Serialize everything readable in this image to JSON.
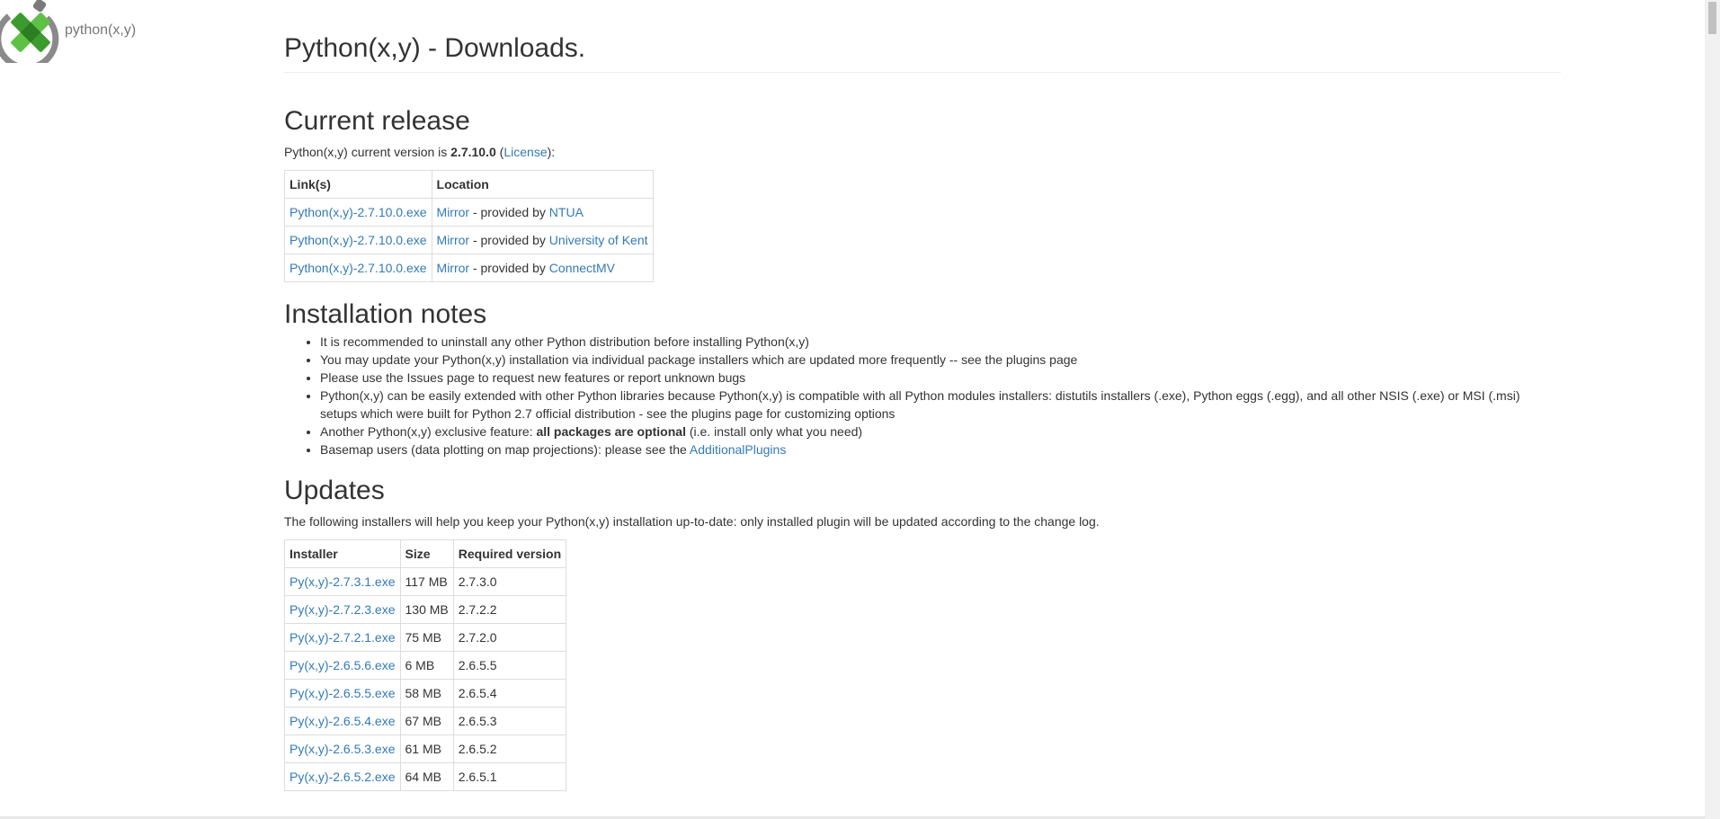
{
  "logo": {
    "icon": "python-xy-logo",
    "text": "python(x,y)"
  },
  "page_title": "Python(x,y) - Downloads.",
  "current_release": {
    "heading": "Current release",
    "intro_prefix": "Python(x,y) current version is ",
    "version": "2.7.10.0",
    "intro_mid": " (",
    "license_link": "License",
    "intro_suffix": "):",
    "table": {
      "headers": [
        "Link(s)",
        "Location"
      ],
      "rows": [
        {
          "link": "Python(x,y)-2.7.10.0.exe",
          "mirror": "Mirror",
          "provided": " - provided by ",
          "provider": "NTUA"
        },
        {
          "link": "Python(x,y)-2.7.10.0.exe",
          "mirror": "Mirror",
          "provided": " - provided by ",
          "provider": "University of Kent"
        },
        {
          "link": "Python(x,y)-2.7.10.0.exe",
          "mirror": "Mirror",
          "provided": " - provided by ",
          "provider": "ConnectMV"
        }
      ]
    }
  },
  "installation_notes": {
    "heading": "Installation notes",
    "items": [
      "It is recommended to uninstall any other Python distribution before installing Python(x,y)",
      "You may update your Python(x,y) installation via individual package installers which are updated more frequently -- see the plugins page",
      "Please use the Issues page to request new features or report unknown bugs",
      "Python(x,y) can be easily extended with other Python libraries because Python(x,y) is compatible with all Python modules installers: distutils installers (.exe), Python eggs (.egg), and all other NSIS (.exe) or MSI (.msi) setups which were built for Python 2.7 official distribution - see the plugins page for customizing options"
    ],
    "item5_prefix": "Another Python(x,y) exclusive feature: ",
    "item5_bold": "all packages are optional",
    "item5_suffix": " (i.e. install only what you need)",
    "item6_prefix": "Basemap users (data plotting on map projections): please see the ",
    "item6_link": "AdditionalPlugins"
  },
  "updates": {
    "heading": "Updates",
    "intro": "The following installers will help you keep your Python(x,y) installation up-to-date: only installed plugin will be updated according to the change log.",
    "table": {
      "headers": [
        "Installer",
        "Size",
        "Required version"
      ],
      "rows": [
        {
          "installer": "Py(x,y)-2.7.3.1.exe",
          "size": "117 MB",
          "required": "2.7.3.0"
        },
        {
          "installer": "Py(x,y)-2.7.2.3.exe",
          "size": "130 MB",
          "required": "2.7.2.2"
        },
        {
          "installer": "Py(x,y)-2.7.2.1.exe",
          "size": "75 MB",
          "required": "2.7.2.0"
        },
        {
          "installer": "Py(x,y)-2.6.5.6.exe",
          "size": "6 MB",
          "required": "2.6.5.5"
        },
        {
          "installer": "Py(x,y)-2.6.5.5.exe",
          "size": "58 MB",
          "required": "2.6.5.4"
        },
        {
          "installer": "Py(x,y)-2.6.5.4.exe",
          "size": "67 MB",
          "required": "2.6.5.3"
        },
        {
          "installer": "Py(x,y)-2.6.5.3.exe",
          "size": "61 MB",
          "required": "2.6.5.2"
        },
        {
          "installer": "Py(x,y)-2.6.5.2.exe",
          "size": "64 MB",
          "required": "2.6.5.1"
        }
      ]
    }
  },
  "colors": {
    "link": "#337ab7",
    "text": "#333333",
    "border": "#dddddd"
  }
}
